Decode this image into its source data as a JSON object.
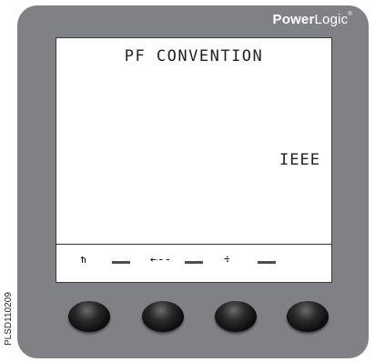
{
  "brand": {
    "bold": "Power",
    "light": "Logic",
    "mark": "®"
  },
  "display": {
    "title": "PF CONVENTION",
    "value": "IEEE"
  },
  "softkeys": [
    {
      "label": "⇈",
      "icon": "up-to-top-arrow-icon"
    },
    {
      "label": "←--",
      "icon": "back-arrow-icon"
    },
    {
      "label": "÷",
      "icon": "increment-icon"
    },
    {
      "label": "",
      "icon": ""
    }
  ],
  "image_code": "PLSD110209",
  "colors": {
    "bezel": "#7f8185",
    "screen": "#ffffff",
    "button": "#111111"
  }
}
